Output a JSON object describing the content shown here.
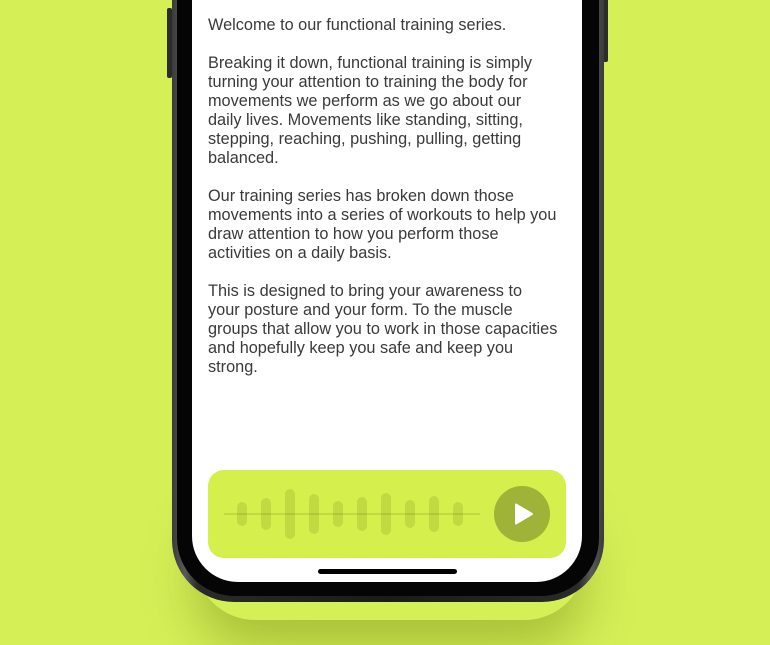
{
  "article": {
    "paragraphs": [
      "Welcome to our functional training series.",
      "Breaking it down, functional training is simply turning your attention to training the body for movements we perform as we go about our daily lives. Movements like standing, sitting, stepping, reaching, pushing, pulling, getting balanced.",
      "Our training series has broken down those movements into a series of workouts to help you draw attention to how you perform those activities on a daily basis.",
      "This is designed to bring your awareness to your posture and your form. To the muscle groups that allow you to work in those capacities and hopefully keep you safe and keep you strong."
    ]
  },
  "player": {
    "play_icon": "play-icon",
    "wave_levels": [
      0.3,
      0.5,
      1.0,
      0.7,
      0.35,
      0.55,
      0.8,
      0.4,
      0.6,
      0.3
    ],
    "colors": {
      "background": "#d5ef4c",
      "button": "#9eb337",
      "icon": "#ffffff"
    }
  },
  "colors": {
    "page_background": "#d5ef57",
    "screen_background": "#ffffff",
    "text": "#3a3a3a"
  }
}
